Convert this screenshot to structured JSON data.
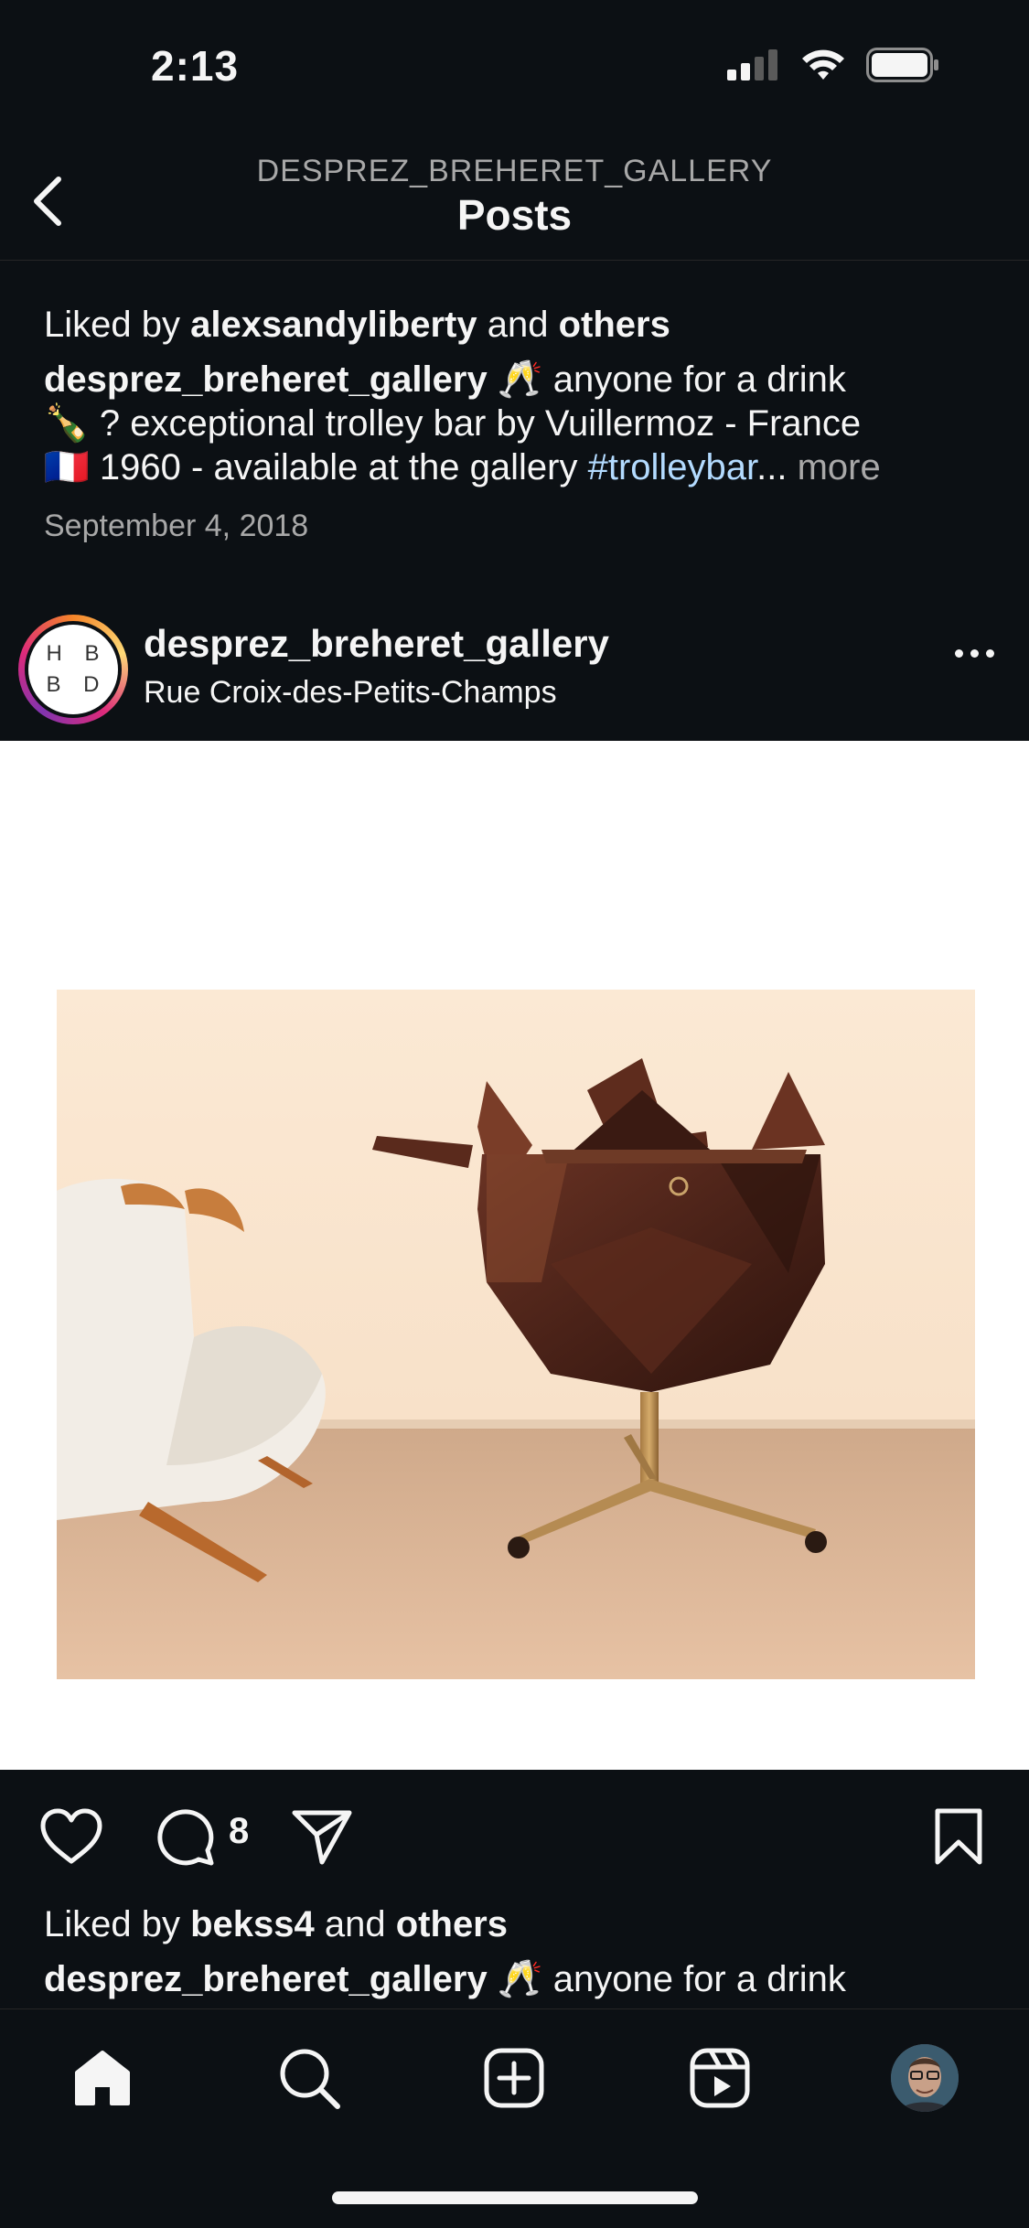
{
  "status_bar": {
    "time": "2:13"
  },
  "header": {
    "subtitle": "DESPREZ_BREHERET_GALLERY",
    "title": "Posts"
  },
  "prev_post": {
    "likes_prefix": "Liked by ",
    "likes_user": "alexsandyliberty",
    "likes_and": " and ",
    "likes_others": "others",
    "caption_user": "desprez_breheret_gallery",
    "caption_line1": " 🥂 anyone for a drink",
    "caption_line2": "🍾 ? exceptional trolley bar by Vuillermoz - France",
    "caption_line3": "🇫🇷 1960 - available at the gallery ",
    "hashtag": "#trolleybar",
    "ellipsis": "... ",
    "more": "more",
    "date": "September 4, 2018"
  },
  "post": {
    "avatar_text_line1": "H B",
    "avatar_text_line2": "B D",
    "username": "desprez_breheret_gallery",
    "location": "Rue Croix-des-Petits-Champs",
    "comment_count": "8",
    "likes_prefix": "Liked by ",
    "likes_user": "bekss4",
    "likes_and": " and ",
    "likes_others": "others",
    "caption_user": "desprez_breheret_gallery",
    "caption_line1": " 🥂 anyone for a drink"
  },
  "icons": {
    "back": "chevron-left-icon",
    "like": "heart-icon",
    "comment": "comment-icon",
    "share": "send-icon",
    "save": "bookmark-icon",
    "home": "home-icon",
    "search": "search-icon",
    "create": "plus-square-icon",
    "reels": "reels-icon",
    "profile": "avatar"
  },
  "colors": {
    "background": "#0c1014",
    "text": "#f5f5f5",
    "secondary": "#a8a8a8",
    "link": "#b3dbff"
  }
}
